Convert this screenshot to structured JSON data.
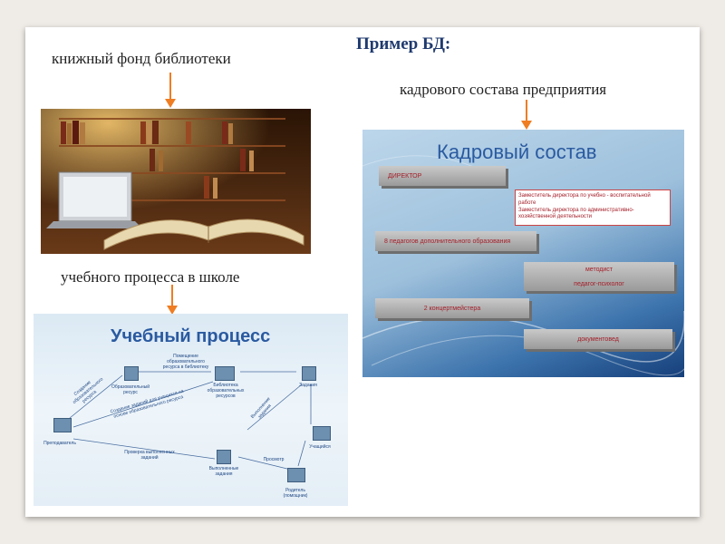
{
  "title": "Пример БД:",
  "captions": {
    "library": "книжный фонд библиотеки",
    "staff": "кадрового состава предприятия",
    "process": "учебного процесса в школе"
  },
  "staff_diagram": {
    "title": "Кадровый состав",
    "director": "ДИРЕКТОР",
    "deputies": [
      "Заместитель директора по учебно - воспитательной работе",
      "Заместитель директора по административно-хозяйственной деятельности"
    ],
    "teachers": "8 педагогов дополнительного образования",
    "methodist": "методист",
    "psychologist": "педагог-психолог",
    "concertmasters": "2 концертмейстера",
    "documentalist": "документовед"
  },
  "process_diagram": {
    "title": "Учебный процесс",
    "labels": {
      "teacher": "Преподаватель",
      "resource": "Образовательный ресурс",
      "placing": "Помещение образовательного ресурса в библиотеку",
      "library": "Библиотека образовательных ресурсов",
      "tasks": "Задания",
      "student": "Учащийся",
      "completed": "Выполненные задания",
      "parent": "Родитель (помощник)",
      "create": "Создание образовательного ресурса",
      "creating_tasks": "Создание заданий для учащихся на основе образовательного ресурса",
      "checking": "Проверка выполненных заданий",
      "perform": "Выполнение задания",
      "view": "Просмотр"
    }
  }
}
